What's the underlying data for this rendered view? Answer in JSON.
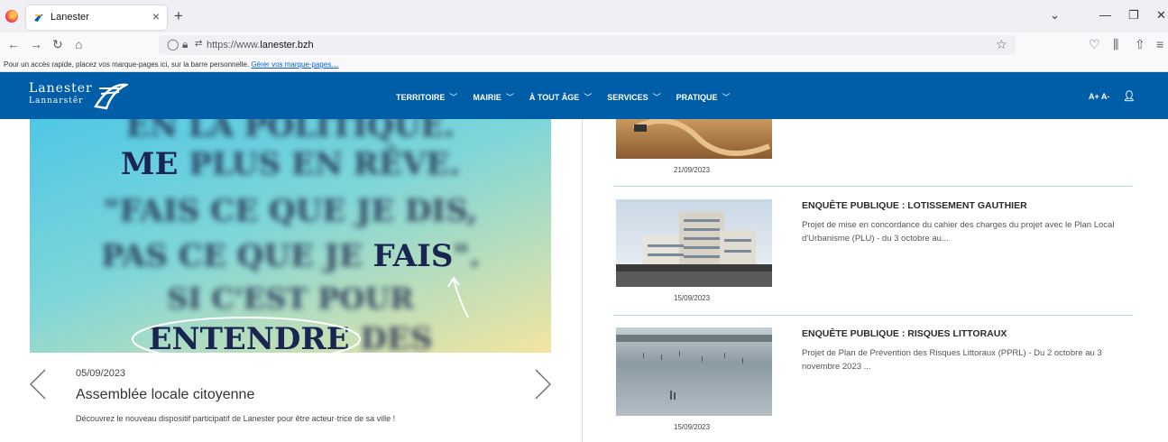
{
  "browser": {
    "tab_title": "Lanester",
    "url_prefix": "https://www.",
    "url_domain": "lanester.bzh",
    "bookmark_hint": "Pour un accès rapide, placez vos marque-pages ici, sur la barre personnelle.",
    "bookmark_link": "Gérer vos marque-pages…"
  },
  "site": {
    "logo_top": "Lanester",
    "logo_bottom": "Lannarstêr",
    "menu": [
      "TERRITOIRE",
      "MAIRIE",
      "À TOUT ÂGE",
      "SERVICES",
      "PRATIQUE"
    ],
    "accessibility": "A+  A-"
  },
  "slide": {
    "lines": [
      "EN LA POLITIQUE.",
      "ME",
      "PLUS EN RÊVE.",
      "\"FAIS CE QUE JE DIS,",
      "PAS CE QUE JE",
      "FAIS",
      "SI C'EST POUR",
      "ENTENDRE",
      "DES"
    ],
    "date": "05/09/2023",
    "title": "Assemblée locale citoyenne",
    "description": "Découvrez le nouveau dispositif participatif de Lanester pour être acteur·trice de sa ville !"
  },
  "news": [
    {
      "date": "21/09/2023",
      "title": "",
      "description": ""
    },
    {
      "date": "15/09/2023",
      "title": "ENQUÊTE PUBLIQUE : LOTISSEMENT GAUTHIER",
      "description": "Projet de mise en concordance du cahier des charges du projet avec le Plan Local d'Urbanisme (PLU) - du 3 octobre au..."
    },
    {
      "date": "15/09/2023",
      "title": "ENQUÊTE PUBLIQUE : RISQUES LITTORAUX",
      "description": "Projet de Plan de Prévention des Risques Littoraux (PPRL) - Du 2 octobre au 3 novembre 2023 ..."
    }
  ],
  "colors": {
    "header": "#005da8",
    "separator": "#bcd6e6"
  }
}
